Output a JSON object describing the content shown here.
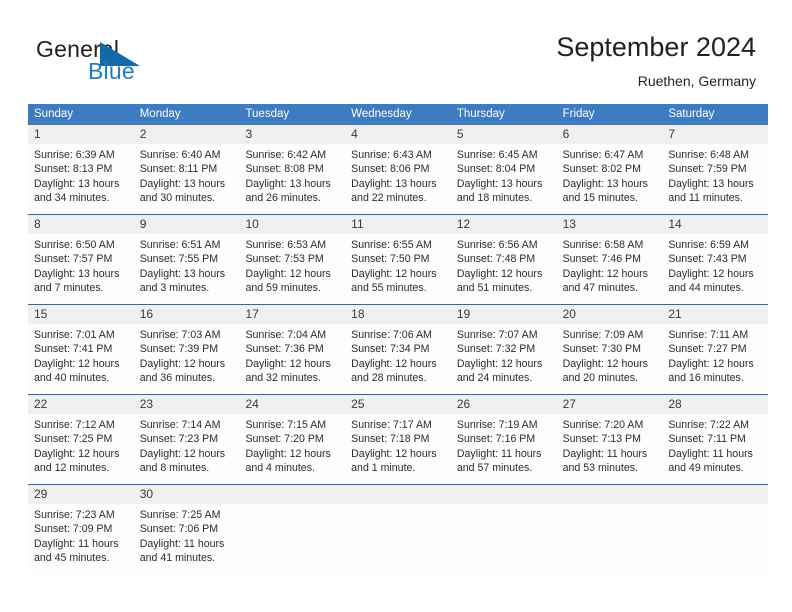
{
  "logo": {
    "word_top": "General",
    "word_bottom": "Blue",
    "triangle_icon": "triangle-icon",
    "color_blue": "#1a7fc1",
    "color_dark": "#231f20"
  },
  "header": {
    "title": "September 2024",
    "location": "Ruethen, Germany"
  },
  "theme": {
    "header_blue": "#3d7cc0",
    "rule_blue": "#2a6aad",
    "num_band": "#f0f0f0",
    "body_bg": "#fdfdfd"
  },
  "weekdays": [
    "Sunday",
    "Monday",
    "Tuesday",
    "Wednesday",
    "Thursday",
    "Friday",
    "Saturday"
  ],
  "weeks": [
    [
      {
        "day": "1",
        "sunrise": "Sunrise: 6:39 AM",
        "sunset": "Sunset: 8:13 PM",
        "daylight1": "Daylight: 13 hours",
        "daylight2": "and 34 minutes."
      },
      {
        "day": "2",
        "sunrise": "Sunrise: 6:40 AM",
        "sunset": "Sunset: 8:11 PM",
        "daylight1": "Daylight: 13 hours",
        "daylight2": "and 30 minutes."
      },
      {
        "day": "3",
        "sunrise": "Sunrise: 6:42 AM",
        "sunset": "Sunset: 8:08 PM",
        "daylight1": "Daylight: 13 hours",
        "daylight2": "and 26 minutes."
      },
      {
        "day": "4",
        "sunrise": "Sunrise: 6:43 AM",
        "sunset": "Sunset: 8:06 PM",
        "daylight1": "Daylight: 13 hours",
        "daylight2": "and 22 minutes."
      },
      {
        "day": "5",
        "sunrise": "Sunrise: 6:45 AM",
        "sunset": "Sunset: 8:04 PM",
        "daylight1": "Daylight: 13 hours",
        "daylight2": "and 18 minutes."
      },
      {
        "day": "6",
        "sunrise": "Sunrise: 6:47 AM",
        "sunset": "Sunset: 8:02 PM",
        "daylight1": "Daylight: 13 hours",
        "daylight2": "and 15 minutes."
      },
      {
        "day": "7",
        "sunrise": "Sunrise: 6:48 AM",
        "sunset": "Sunset: 7:59 PM",
        "daylight1": "Daylight: 13 hours",
        "daylight2": "and 11 minutes."
      }
    ],
    [
      {
        "day": "8",
        "sunrise": "Sunrise: 6:50 AM",
        "sunset": "Sunset: 7:57 PM",
        "daylight1": "Daylight: 13 hours",
        "daylight2": "and 7 minutes."
      },
      {
        "day": "9",
        "sunrise": "Sunrise: 6:51 AM",
        "sunset": "Sunset: 7:55 PM",
        "daylight1": "Daylight: 13 hours",
        "daylight2": "and 3 minutes."
      },
      {
        "day": "10",
        "sunrise": "Sunrise: 6:53 AM",
        "sunset": "Sunset: 7:53 PM",
        "daylight1": "Daylight: 12 hours",
        "daylight2": "and 59 minutes."
      },
      {
        "day": "11",
        "sunrise": "Sunrise: 6:55 AM",
        "sunset": "Sunset: 7:50 PM",
        "daylight1": "Daylight: 12 hours",
        "daylight2": "and 55 minutes."
      },
      {
        "day": "12",
        "sunrise": "Sunrise: 6:56 AM",
        "sunset": "Sunset: 7:48 PM",
        "daylight1": "Daylight: 12 hours",
        "daylight2": "and 51 minutes."
      },
      {
        "day": "13",
        "sunrise": "Sunrise: 6:58 AM",
        "sunset": "Sunset: 7:46 PM",
        "daylight1": "Daylight: 12 hours",
        "daylight2": "and 47 minutes."
      },
      {
        "day": "14",
        "sunrise": "Sunrise: 6:59 AM",
        "sunset": "Sunset: 7:43 PM",
        "daylight1": "Daylight: 12 hours",
        "daylight2": "and 44 minutes."
      }
    ],
    [
      {
        "day": "15",
        "sunrise": "Sunrise: 7:01 AM",
        "sunset": "Sunset: 7:41 PM",
        "daylight1": "Daylight: 12 hours",
        "daylight2": "and 40 minutes."
      },
      {
        "day": "16",
        "sunrise": "Sunrise: 7:03 AM",
        "sunset": "Sunset: 7:39 PM",
        "daylight1": "Daylight: 12 hours",
        "daylight2": "and 36 minutes."
      },
      {
        "day": "17",
        "sunrise": "Sunrise: 7:04 AM",
        "sunset": "Sunset: 7:36 PM",
        "daylight1": "Daylight: 12 hours",
        "daylight2": "and 32 minutes."
      },
      {
        "day": "18",
        "sunrise": "Sunrise: 7:06 AM",
        "sunset": "Sunset: 7:34 PM",
        "daylight1": "Daylight: 12 hours",
        "daylight2": "and 28 minutes."
      },
      {
        "day": "19",
        "sunrise": "Sunrise: 7:07 AM",
        "sunset": "Sunset: 7:32 PM",
        "daylight1": "Daylight: 12 hours",
        "daylight2": "and 24 minutes."
      },
      {
        "day": "20",
        "sunrise": "Sunrise: 7:09 AM",
        "sunset": "Sunset: 7:30 PM",
        "daylight1": "Daylight: 12 hours",
        "daylight2": "and 20 minutes."
      },
      {
        "day": "21",
        "sunrise": "Sunrise: 7:11 AM",
        "sunset": "Sunset: 7:27 PM",
        "daylight1": "Daylight: 12 hours",
        "daylight2": "and 16 minutes."
      }
    ],
    [
      {
        "day": "22",
        "sunrise": "Sunrise: 7:12 AM",
        "sunset": "Sunset: 7:25 PM",
        "daylight1": "Daylight: 12 hours",
        "daylight2": "and 12 minutes."
      },
      {
        "day": "23",
        "sunrise": "Sunrise: 7:14 AM",
        "sunset": "Sunset: 7:23 PM",
        "daylight1": "Daylight: 12 hours",
        "daylight2": "and 8 minutes."
      },
      {
        "day": "24",
        "sunrise": "Sunrise: 7:15 AM",
        "sunset": "Sunset: 7:20 PM",
        "daylight1": "Daylight: 12 hours",
        "daylight2": "and 4 minutes."
      },
      {
        "day": "25",
        "sunrise": "Sunrise: 7:17 AM",
        "sunset": "Sunset: 7:18 PM",
        "daylight1": "Daylight: 12 hours",
        "daylight2": "and 1 minute."
      },
      {
        "day": "26",
        "sunrise": "Sunrise: 7:19 AM",
        "sunset": "Sunset: 7:16 PM",
        "daylight1": "Daylight: 11 hours",
        "daylight2": "and 57 minutes."
      },
      {
        "day": "27",
        "sunrise": "Sunrise: 7:20 AM",
        "sunset": "Sunset: 7:13 PM",
        "daylight1": "Daylight: 11 hours",
        "daylight2": "and 53 minutes."
      },
      {
        "day": "28",
        "sunrise": "Sunrise: 7:22 AM",
        "sunset": "Sunset: 7:11 PM",
        "daylight1": "Daylight: 11 hours",
        "daylight2": "and 49 minutes."
      }
    ],
    [
      {
        "day": "29",
        "sunrise": "Sunrise: 7:23 AM",
        "sunset": "Sunset: 7:09 PM",
        "daylight1": "Daylight: 11 hours",
        "daylight2": "and 45 minutes."
      },
      {
        "day": "30",
        "sunrise": "Sunrise: 7:25 AM",
        "sunset": "Sunset: 7:06 PM",
        "daylight1": "Daylight: 11 hours",
        "daylight2": "and 41 minutes."
      },
      {
        "day": "",
        "sunrise": "",
        "sunset": "",
        "daylight1": "",
        "daylight2": ""
      },
      {
        "day": "",
        "sunrise": "",
        "sunset": "",
        "daylight1": "",
        "daylight2": ""
      },
      {
        "day": "",
        "sunrise": "",
        "sunset": "",
        "daylight1": "",
        "daylight2": ""
      },
      {
        "day": "",
        "sunrise": "",
        "sunset": "",
        "daylight1": "",
        "daylight2": ""
      },
      {
        "day": "",
        "sunrise": "",
        "sunset": "",
        "daylight1": "",
        "daylight2": ""
      }
    ]
  ]
}
